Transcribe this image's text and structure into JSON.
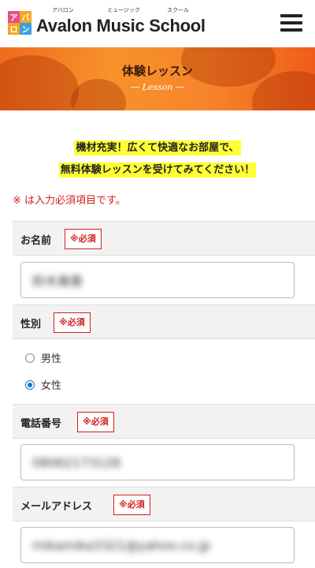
{
  "header": {
    "logo_mark": [
      "ア",
      "バ",
      "ロ",
      "ン"
    ],
    "logo_text": "Avalon Music School",
    "ruby": [
      "アバロン",
      "ミュージック",
      "スクール"
    ]
  },
  "hero": {
    "title": "体験レッスン",
    "subtitle": "― Lesson ―"
  },
  "intro": {
    "line1": "機材充実！広くて快適なお部屋で、",
    "line2": "無料体験レッスンを受けてみてください！"
  },
  "required_note": "※ は入力必須項目です。",
  "form": {
    "name": {
      "label": "お名前",
      "required": "※必須",
      "value": "鈴木美香"
    },
    "gender": {
      "label": "性別",
      "required": "※必須",
      "options": [
        "男性",
        "女性"
      ],
      "selected": "女性"
    },
    "phone": {
      "label": "電話番号",
      "required": "※必須",
      "value": "08062173128"
    },
    "email": {
      "label": "メールアドレス",
      "required": "※必須",
      "value": "mikamika3321@yahoo.co.jp"
    }
  },
  "colors": {
    "accent": "#f28a2a",
    "required": "#d02020",
    "highlight": "#ffff33",
    "radio": "#1a6fd8"
  }
}
